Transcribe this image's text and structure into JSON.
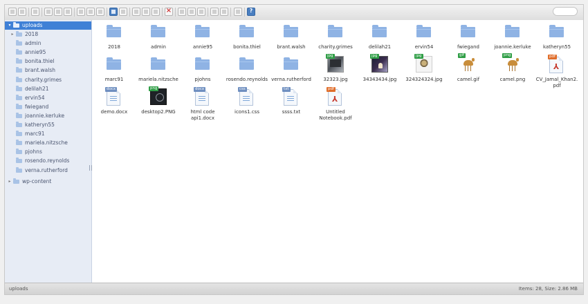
{
  "sidebar": {
    "root": "uploads",
    "children": [
      "2018",
      "admin",
      "annie95",
      "bonita.thiel",
      "brant.walsh",
      "charity.grimes",
      "delilah21",
      "ervin54",
      "fwiegand",
      "joannie.kerluke",
      "katheryn55",
      "marc91",
      "mariela.nitzsche",
      "pjohns",
      "rosendo.reynolds",
      "verna.rutherford"
    ],
    "sibling": "wp-content"
  },
  "files": [
    {
      "name": "2018",
      "kind": "folder"
    },
    {
      "name": "admin",
      "kind": "folder"
    },
    {
      "name": "annie95",
      "kind": "folder"
    },
    {
      "name": "bonita.thiel",
      "kind": "folder"
    },
    {
      "name": "brant.walsh",
      "kind": "folder"
    },
    {
      "name": "charity.grimes",
      "kind": "folder"
    },
    {
      "name": "delilah21",
      "kind": "folder"
    },
    {
      "name": "ervin54",
      "kind": "folder"
    },
    {
      "name": "fwiegand",
      "kind": "folder"
    },
    {
      "name": "joannie.kerluke",
      "kind": "folder"
    },
    {
      "name": "katheryn55",
      "kind": "folder"
    },
    {
      "name": "marc91",
      "kind": "folder"
    },
    {
      "name": "mariela.nitzsche",
      "kind": "folder"
    },
    {
      "name": "pjohns",
      "kind": "folder"
    },
    {
      "name": "rosendo.reynolds",
      "kind": "folder"
    },
    {
      "name": "verna.rutherford",
      "kind": "folder"
    },
    {
      "name": "32323.jpg",
      "kind": "photo1",
      "badge": "jpg"
    },
    {
      "name": "34343434.jpg",
      "kind": "photo2",
      "badge": "jpg"
    },
    {
      "name": "324324324.jpg",
      "kind": "photo3",
      "badge": "jpg"
    },
    {
      "name": "camel.gif",
      "kind": "camel",
      "badge": "gif"
    },
    {
      "name": "camel.png",
      "kind": "camel",
      "badge": "png"
    },
    {
      "name": "CV_Jamal_Khan2.pdf",
      "kind": "pdf",
      "badge": "pdf"
    },
    {
      "name": "demo.docx",
      "kind": "doc",
      "badge": "docx"
    },
    {
      "name": "desktop2.PNG",
      "kind": "dark",
      "badge": "png"
    },
    {
      "name": "html code api1.docx",
      "kind": "doc",
      "badge": "docx"
    },
    {
      "name": "icons1.css",
      "kind": "doc",
      "badge": "css"
    },
    {
      "name": "ssss.txt",
      "kind": "doc",
      "badge": "txt"
    },
    {
      "name": "Untitled Notebook.pdf",
      "kind": "pdf",
      "badge": "pdf"
    }
  ],
  "status": {
    "path": "uploads",
    "summary": "Items: 28, Size: 2.86 MB"
  },
  "colors": {
    "selection": "#3f80d6",
    "folder": "#8fb3e4",
    "sidebar": "#e7ecf5"
  }
}
